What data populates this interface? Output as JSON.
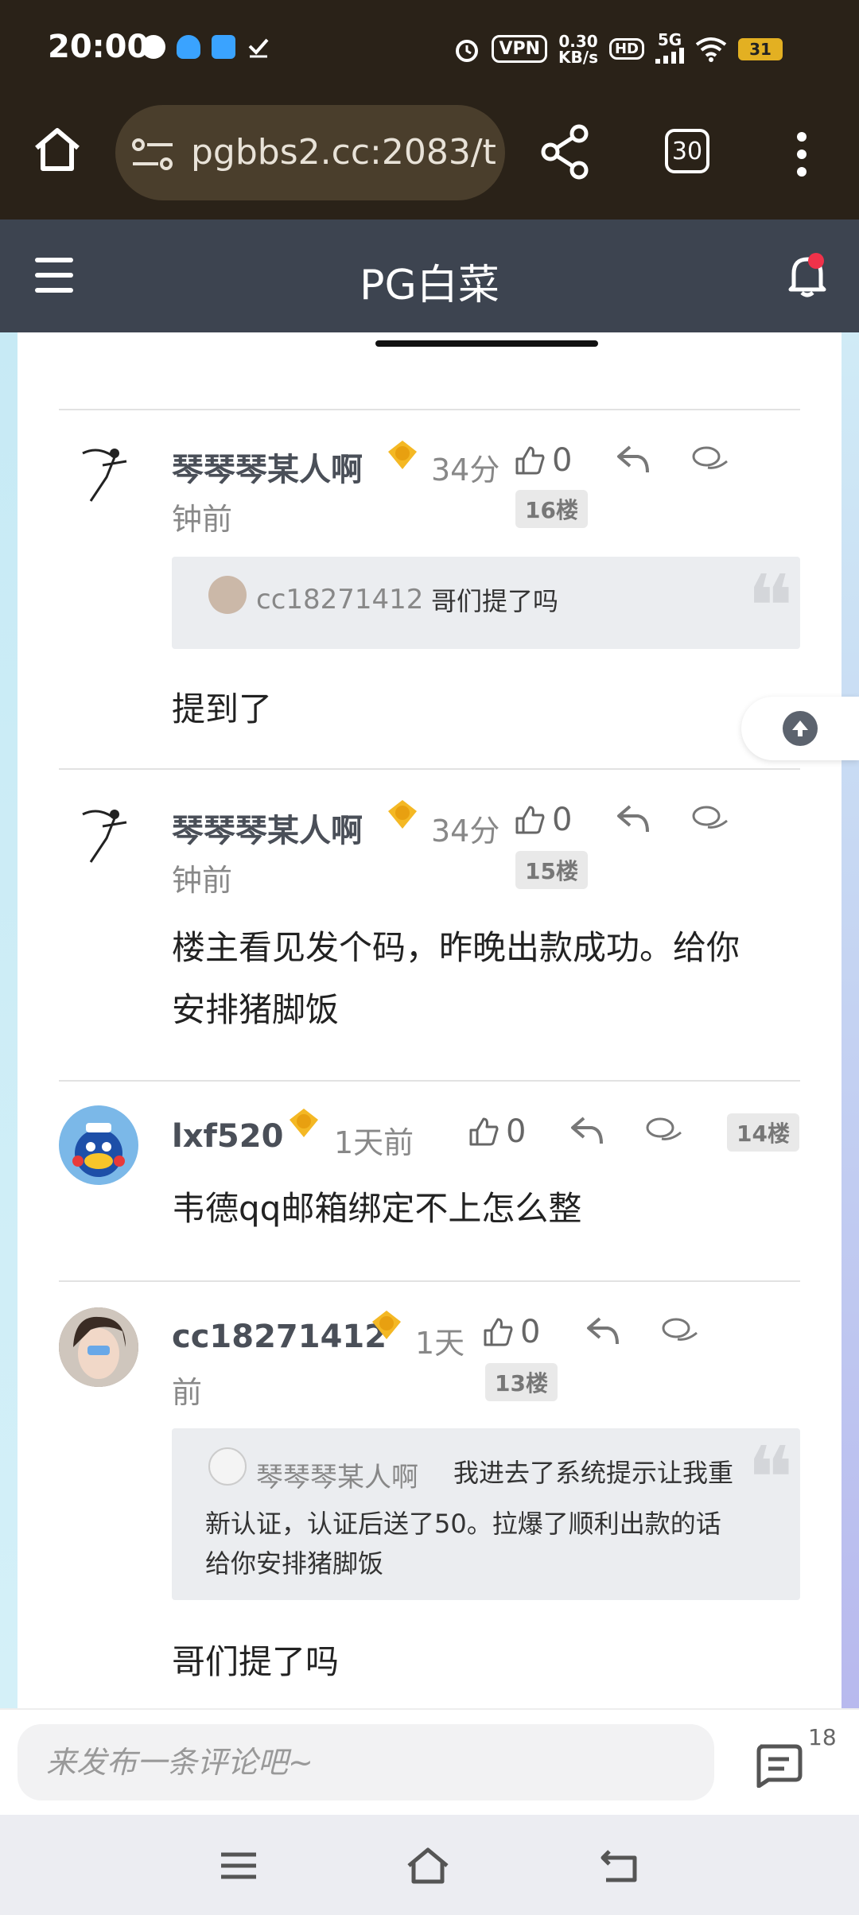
{
  "status_bar": {
    "time": "20:00",
    "vpn": "VPN",
    "speed_top": "0.30",
    "speed_bottom": "KB/s",
    "hd": "HD",
    "net": "5G",
    "battery": "31"
  },
  "browser": {
    "url": "pgbbs2.cc:2083/t",
    "tab_count": "30"
  },
  "site": {
    "title": "PG白菜"
  },
  "comments": [
    {
      "user": "琴琴琴某人啊",
      "level": "3",
      "time_line1": "34分",
      "time_line2": "钟前",
      "likes": "0",
      "floor": "16楼",
      "quote": {
        "user": "cc18271412",
        "text": "哥们提了吗"
      },
      "text": "提到了"
    },
    {
      "user": "琴琴琴某人啊",
      "level": "3",
      "time_line1": "34分",
      "time_line2": "钟前",
      "likes": "0",
      "floor": "15楼",
      "text_line1": "楼主看见发个码，昨晚出款成功。给你",
      "text_line2": "安排猪脚饭"
    },
    {
      "user": "lxf520",
      "level": "3",
      "time_line1": "1天前",
      "likes": "0",
      "floor": "14楼",
      "text": "韦德qq邮箱绑定不上怎么整"
    },
    {
      "user": "cc18271412",
      "level": "1",
      "time_line1": "1天",
      "time_line2": "前",
      "likes": "0",
      "floor": "13楼",
      "quote": {
        "user": "琴琴琴某人啊",
        "text_line1": "我进去了系统提示让我重",
        "text_line2": "新认证，认证后送了50。拉爆了顺利出款的话",
        "text_line3": "给你安排猪脚饭"
      },
      "text": "哥们提了吗"
    }
  ],
  "comment_bar": {
    "placeholder": "来发布一条评论吧~",
    "count": "18"
  },
  "colors": {
    "browser_bg": "#2a2218",
    "header_bg": "#3d4450",
    "notification_dot": "#f0324a"
  }
}
